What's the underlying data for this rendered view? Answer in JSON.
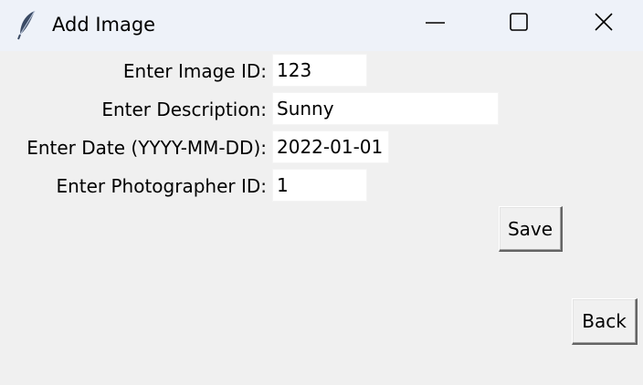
{
  "window": {
    "title": "Add Image",
    "app_icon": "feather-icon",
    "controls": [
      "minimize-icon",
      "maximize-icon",
      "close-icon"
    ]
  },
  "form": {
    "image_id": {
      "label": "Enter Image ID:",
      "value": "123"
    },
    "description": {
      "label": "Enter Description:",
      "value": "Sunny"
    },
    "date": {
      "label": "Enter Date (YYYY-MM-DD):",
      "value": "2022-01-01"
    },
    "photographer_id": {
      "label": "Enter Photographer ID:",
      "value": "1"
    }
  },
  "buttons": {
    "save_label": "Save",
    "back_label": "Back"
  }
}
